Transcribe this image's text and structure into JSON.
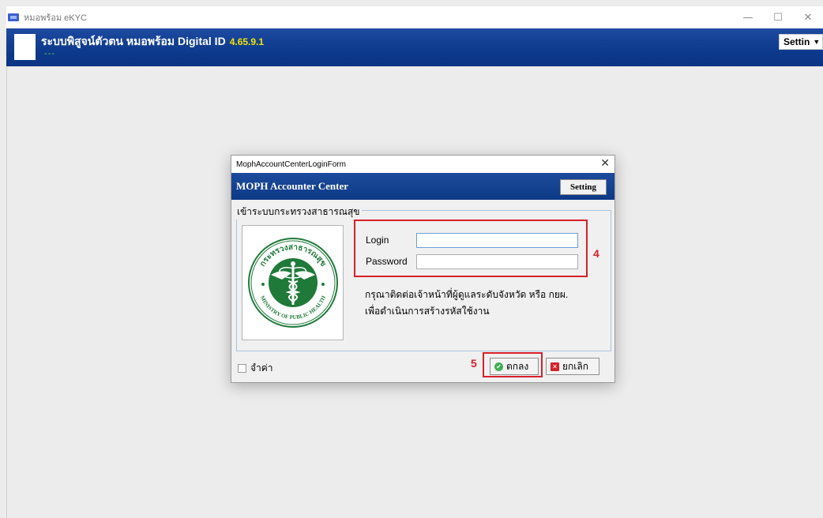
{
  "window": {
    "title": "หมอพร้อม eKYC",
    "minimize": "—",
    "maximize": "☐",
    "close": "✕"
  },
  "header": {
    "title": "ระบบพิสูจน์ตัวตน หมอพร้อม Digital ID",
    "version": "4.65.9.1",
    "subtitle": "---",
    "settings_label": "Settin",
    "settings_caret": "▼"
  },
  "dialog": {
    "window_title": "MophAccountCenterLoginForm",
    "close": "✕",
    "header_title": "MOPH  Accounter Center",
    "setting_button": "Setting",
    "group_title": "เข้าระบบกระทรวงสาธารณสุข",
    "emblem": {
      "text_top": "กระทรวงสาธารณสุข",
      "text_bottom": "MINISTRY OF PUBLIC HEALTH"
    },
    "login_label": "Login",
    "login_value": "",
    "password_label": "Password",
    "password_value": "",
    "info_line1": "กรุณาติดต่อเจ้าหน้าที่ผู้ดูแลระดับจังหวัด หรือ กยผ.",
    "info_line2": "เพื่อดำเนินการสร้างรหัสใช้งาน",
    "remember_label": "จำค่า",
    "ok_label": "ตกลง",
    "cancel_label": "ยกเลิก"
  },
  "annotations": {
    "step_4": "4",
    "step_5": "5",
    "color": "#d8202a"
  }
}
